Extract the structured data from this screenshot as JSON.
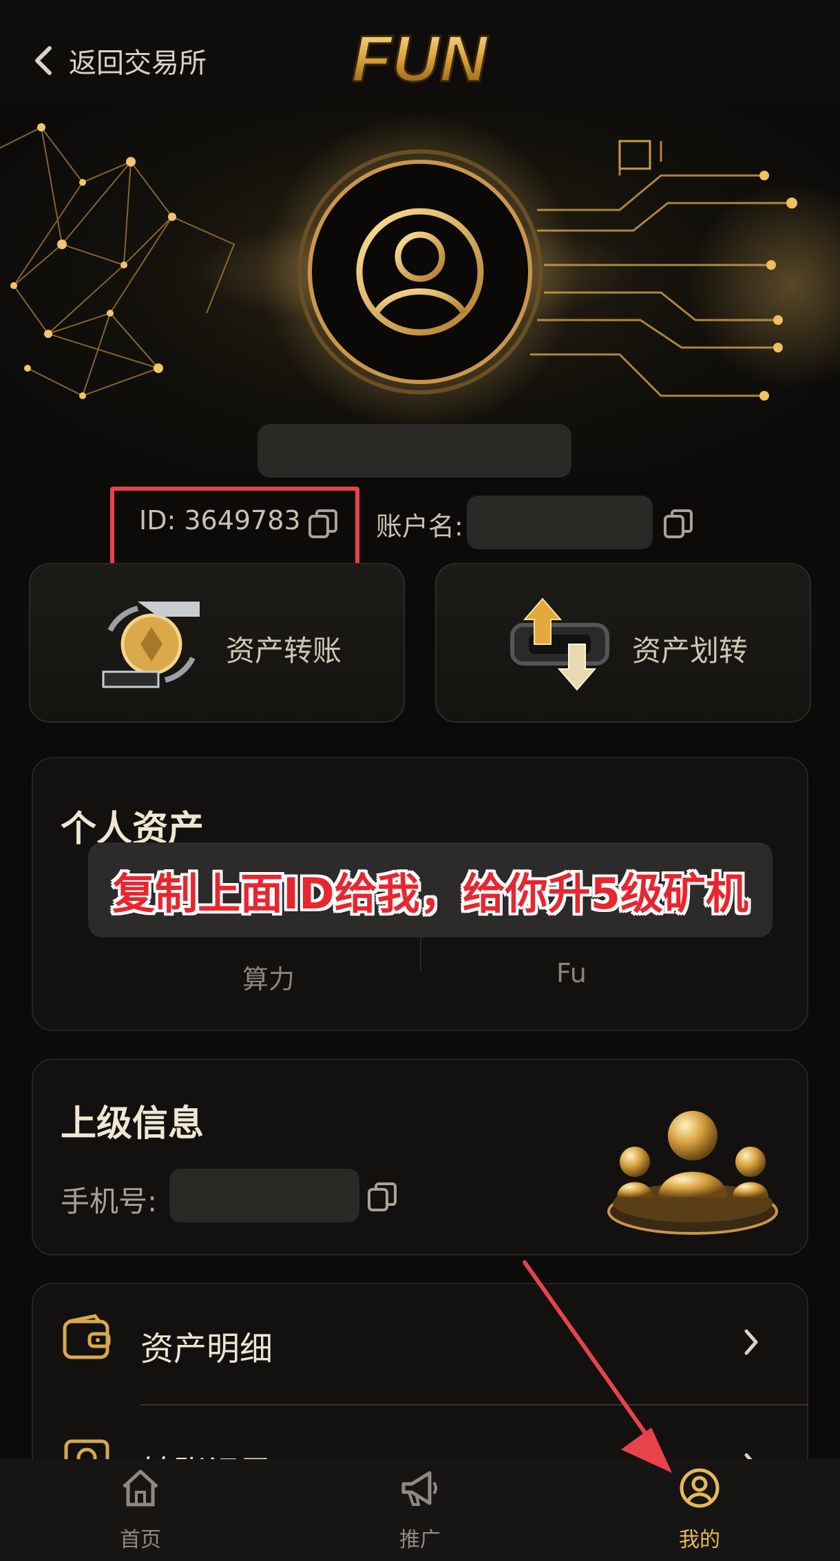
{
  "header": {
    "back_label": "返回交易所",
    "logo_text": "FUN"
  },
  "profile": {
    "id_text": "ID: 3649783",
    "account_label": "账户名:"
  },
  "actions": [
    {
      "label": "资产转账",
      "icon": "coin-transfer-icon"
    },
    {
      "label": "资产划转",
      "icon": "swap-arrows-icon"
    }
  ],
  "assets_card": {
    "title": "个人资产",
    "overlay_banner": "复制上面ID给我，给你升5级矿机",
    "stats": [
      {
        "label": "算力"
      },
      {
        "label": "Fu"
      }
    ]
  },
  "superior_card": {
    "title": "上级信息",
    "phone_label": "手机号:"
  },
  "menu": [
    {
      "label": "资产明细",
      "icon": "wallet-icon"
    },
    {
      "label": "转账记录",
      "icon": "record-icon"
    }
  ],
  "tabbar": [
    {
      "label": "首页",
      "icon": "home-icon",
      "active": false
    },
    {
      "label": "推广",
      "icon": "megaphone-icon",
      "active": false
    },
    {
      "label": "我的",
      "icon": "profile-icon",
      "active": true
    }
  ],
  "colors": {
    "background": "#0c0b09",
    "gold_accent": "#d9a94a",
    "annotation_red": "#e8434a"
  }
}
